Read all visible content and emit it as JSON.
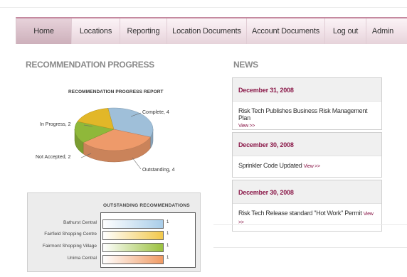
{
  "nav": {
    "items": [
      {
        "label": "Home",
        "active": true
      },
      {
        "label": "Locations",
        "active": false
      },
      {
        "label": "Reporting",
        "active": false
      },
      {
        "label": "Location Documents",
        "active": false
      },
      {
        "label": "Account Documents",
        "active": false
      },
      {
        "label": "Log out",
        "active": false
      },
      {
        "label": "Admin",
        "active": false
      }
    ]
  },
  "progress": {
    "heading": "RECOMMENDATION PROGRESS",
    "chart_title": "RECOMMENDATION PROGRESS REPORT"
  },
  "news": {
    "heading": "NEWS",
    "items": [
      {
        "date": "December 31, 2008",
        "text": "Risk Tech Publishes Business Risk Management Plan",
        "view": "View >>"
      },
      {
        "date": "December 30, 2008",
        "text": "Sprinkler Code Updated",
        "view": "View >>"
      },
      {
        "date": "December 30, 2008",
        "text": "Risk Tech Release standard \"Hot Work\" Permit",
        "view": "View >>"
      }
    ]
  },
  "outstanding": {
    "title": "OUTSTANDING RECOMMENDATIONS"
  },
  "chart_data": [
    {
      "type": "pie",
      "title": "RECOMMENDATION PROGRESS REPORT",
      "slices": [
        {
          "label": "Complete, 4",
          "value": 4,
          "color": "#9fbfd9"
        },
        {
          "label": "Outstanding, 4",
          "value": 4,
          "color": "#ee9a6a"
        },
        {
          "label": "Not Accepted, 2",
          "value": 2,
          "color": "#8fb83a"
        },
        {
          "label": "In Progress, 2",
          "value": 2,
          "color": "#e2b728"
        }
      ]
    },
    {
      "type": "bar",
      "title": "OUTSTANDING RECOMMENDATIONS",
      "categories": [
        "Bathurst Central",
        "Fairfield Shopping Centre",
        "Fairmont Shopping Village",
        "Unima Central"
      ],
      "values": [
        1,
        1,
        1,
        1
      ],
      "value_labels": [
        "1",
        "1",
        "1",
        "1"
      ],
      "colors": [
        "#a9cde9",
        "#f2c84b",
        "#9ac13f",
        "#f09a63"
      ],
      "xlim": [
        0,
        1
      ]
    }
  ]
}
